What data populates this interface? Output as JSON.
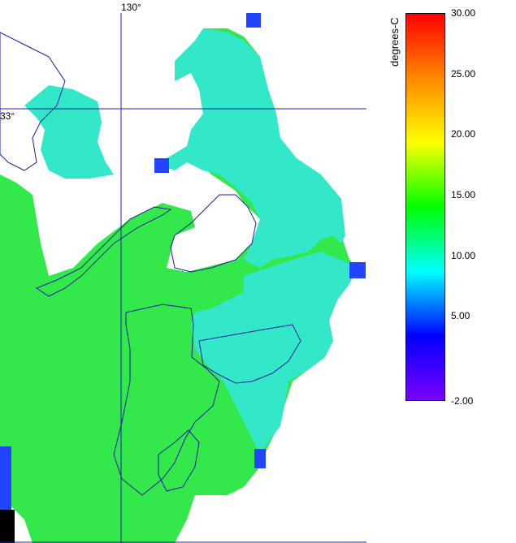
{
  "map": {
    "lon_label": "130°",
    "lat_label": "33°"
  },
  "colorbar": {
    "unit": "degrees-C",
    "ticks": [
      "30.00",
      "25.00",
      "20.00",
      "15.00",
      "10.00",
      "5.00",
      "-2.00"
    ],
    "min": -2,
    "max": 30,
    "colors": [
      "#7a00ff",
      "#0000ff",
      "#00ffff",
      "#00ff00",
      "#ffff00",
      "#ff8800",
      "#ff0000"
    ]
  },
  "palette": {
    "sea_cool": "#33e0d8",
    "sea_mid": "#22dd66",
    "sea_warm": "#33ee22",
    "sea_cold": "#2244ff",
    "coast": "#1a1aa0",
    "grid": "#1f1fb4"
  }
}
